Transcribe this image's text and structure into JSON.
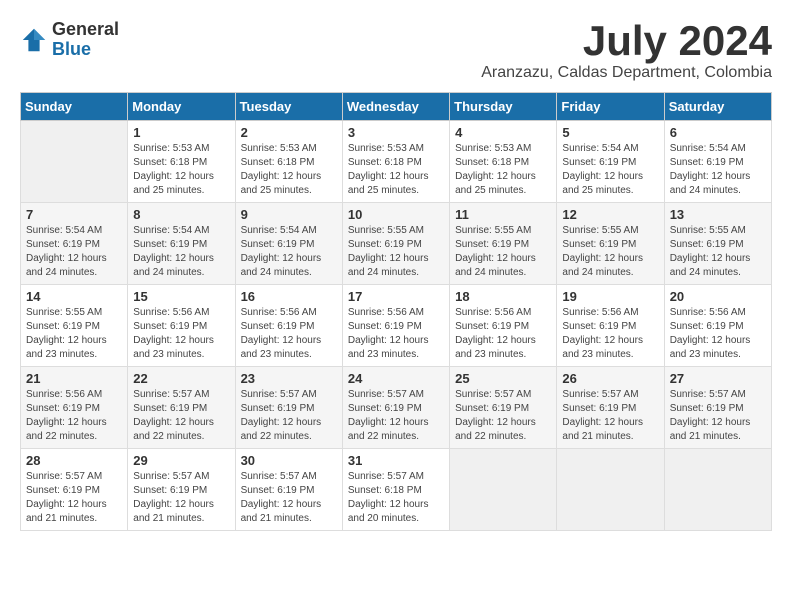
{
  "header": {
    "logo_general": "General",
    "logo_blue": "Blue",
    "month_year": "July 2024",
    "location": "Aranzazu, Caldas Department, Colombia"
  },
  "days_of_week": [
    "Sunday",
    "Monday",
    "Tuesday",
    "Wednesday",
    "Thursday",
    "Friday",
    "Saturday"
  ],
  "weeks": [
    [
      {
        "day": "",
        "sunrise": "",
        "sunset": "",
        "daylight": "",
        "empty": true
      },
      {
        "day": "1",
        "sunrise": "Sunrise: 5:53 AM",
        "sunset": "Sunset: 6:18 PM",
        "daylight": "Daylight: 12 hours and 25 minutes."
      },
      {
        "day": "2",
        "sunrise": "Sunrise: 5:53 AM",
        "sunset": "Sunset: 6:18 PM",
        "daylight": "Daylight: 12 hours and 25 minutes."
      },
      {
        "day": "3",
        "sunrise": "Sunrise: 5:53 AM",
        "sunset": "Sunset: 6:18 PM",
        "daylight": "Daylight: 12 hours and 25 minutes."
      },
      {
        "day": "4",
        "sunrise": "Sunrise: 5:53 AM",
        "sunset": "Sunset: 6:18 PM",
        "daylight": "Daylight: 12 hours and 25 minutes."
      },
      {
        "day": "5",
        "sunrise": "Sunrise: 5:54 AM",
        "sunset": "Sunset: 6:19 PM",
        "daylight": "Daylight: 12 hours and 25 minutes."
      },
      {
        "day": "6",
        "sunrise": "Sunrise: 5:54 AM",
        "sunset": "Sunset: 6:19 PM",
        "daylight": "Daylight: 12 hours and 24 minutes."
      }
    ],
    [
      {
        "day": "7",
        "sunrise": "Sunrise: 5:54 AM",
        "sunset": "Sunset: 6:19 PM",
        "daylight": "Daylight: 12 hours and 24 minutes."
      },
      {
        "day": "8",
        "sunrise": "Sunrise: 5:54 AM",
        "sunset": "Sunset: 6:19 PM",
        "daylight": "Daylight: 12 hours and 24 minutes."
      },
      {
        "day": "9",
        "sunrise": "Sunrise: 5:54 AM",
        "sunset": "Sunset: 6:19 PM",
        "daylight": "Daylight: 12 hours and 24 minutes."
      },
      {
        "day": "10",
        "sunrise": "Sunrise: 5:55 AM",
        "sunset": "Sunset: 6:19 PM",
        "daylight": "Daylight: 12 hours and 24 minutes."
      },
      {
        "day": "11",
        "sunrise": "Sunrise: 5:55 AM",
        "sunset": "Sunset: 6:19 PM",
        "daylight": "Daylight: 12 hours and 24 minutes."
      },
      {
        "day": "12",
        "sunrise": "Sunrise: 5:55 AM",
        "sunset": "Sunset: 6:19 PM",
        "daylight": "Daylight: 12 hours and 24 minutes."
      },
      {
        "day": "13",
        "sunrise": "Sunrise: 5:55 AM",
        "sunset": "Sunset: 6:19 PM",
        "daylight": "Daylight: 12 hours and 24 minutes."
      }
    ],
    [
      {
        "day": "14",
        "sunrise": "Sunrise: 5:55 AM",
        "sunset": "Sunset: 6:19 PM",
        "daylight": "Daylight: 12 hours and 23 minutes."
      },
      {
        "day": "15",
        "sunrise": "Sunrise: 5:56 AM",
        "sunset": "Sunset: 6:19 PM",
        "daylight": "Daylight: 12 hours and 23 minutes."
      },
      {
        "day": "16",
        "sunrise": "Sunrise: 5:56 AM",
        "sunset": "Sunset: 6:19 PM",
        "daylight": "Daylight: 12 hours and 23 minutes."
      },
      {
        "day": "17",
        "sunrise": "Sunrise: 5:56 AM",
        "sunset": "Sunset: 6:19 PM",
        "daylight": "Daylight: 12 hours and 23 minutes."
      },
      {
        "day": "18",
        "sunrise": "Sunrise: 5:56 AM",
        "sunset": "Sunset: 6:19 PM",
        "daylight": "Daylight: 12 hours and 23 minutes."
      },
      {
        "day": "19",
        "sunrise": "Sunrise: 5:56 AM",
        "sunset": "Sunset: 6:19 PM",
        "daylight": "Daylight: 12 hours and 23 minutes."
      },
      {
        "day": "20",
        "sunrise": "Sunrise: 5:56 AM",
        "sunset": "Sunset: 6:19 PM",
        "daylight": "Daylight: 12 hours and 23 minutes."
      }
    ],
    [
      {
        "day": "21",
        "sunrise": "Sunrise: 5:56 AM",
        "sunset": "Sunset: 6:19 PM",
        "daylight": "Daylight: 12 hours and 22 minutes."
      },
      {
        "day": "22",
        "sunrise": "Sunrise: 5:57 AM",
        "sunset": "Sunset: 6:19 PM",
        "daylight": "Daylight: 12 hours and 22 minutes."
      },
      {
        "day": "23",
        "sunrise": "Sunrise: 5:57 AM",
        "sunset": "Sunset: 6:19 PM",
        "daylight": "Daylight: 12 hours and 22 minutes."
      },
      {
        "day": "24",
        "sunrise": "Sunrise: 5:57 AM",
        "sunset": "Sunset: 6:19 PM",
        "daylight": "Daylight: 12 hours and 22 minutes."
      },
      {
        "day": "25",
        "sunrise": "Sunrise: 5:57 AM",
        "sunset": "Sunset: 6:19 PM",
        "daylight": "Daylight: 12 hours and 22 minutes."
      },
      {
        "day": "26",
        "sunrise": "Sunrise: 5:57 AM",
        "sunset": "Sunset: 6:19 PM",
        "daylight": "Daylight: 12 hours and 21 minutes."
      },
      {
        "day": "27",
        "sunrise": "Sunrise: 5:57 AM",
        "sunset": "Sunset: 6:19 PM",
        "daylight": "Daylight: 12 hours and 21 minutes."
      }
    ],
    [
      {
        "day": "28",
        "sunrise": "Sunrise: 5:57 AM",
        "sunset": "Sunset: 6:19 PM",
        "daylight": "Daylight: 12 hours and 21 minutes."
      },
      {
        "day": "29",
        "sunrise": "Sunrise: 5:57 AM",
        "sunset": "Sunset: 6:19 PM",
        "daylight": "Daylight: 12 hours and 21 minutes."
      },
      {
        "day": "30",
        "sunrise": "Sunrise: 5:57 AM",
        "sunset": "Sunset: 6:19 PM",
        "daylight": "Daylight: 12 hours and 21 minutes."
      },
      {
        "day": "31",
        "sunrise": "Sunrise: 5:57 AM",
        "sunset": "Sunset: 6:18 PM",
        "daylight": "Daylight: 12 hours and 20 minutes."
      },
      {
        "day": "",
        "sunrise": "",
        "sunset": "",
        "daylight": "",
        "empty": true
      },
      {
        "day": "",
        "sunrise": "",
        "sunset": "",
        "daylight": "",
        "empty": true
      },
      {
        "day": "",
        "sunrise": "",
        "sunset": "",
        "daylight": "",
        "empty": true
      }
    ]
  ]
}
